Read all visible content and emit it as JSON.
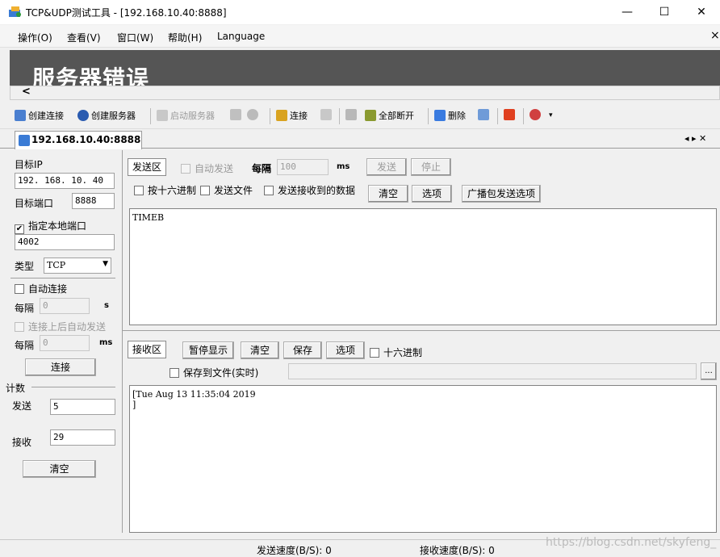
{
  "window": {
    "title": "TCP&UDP测试工具 - [192.168.10.40:8888]",
    "minimize": "—",
    "maximize": "☐",
    "close": "✕"
  },
  "menu": {
    "items": [
      "操作(O)",
      "查看(V)",
      "窗口(W)",
      "帮助(H)",
      "Language"
    ],
    "close": "×"
  },
  "banner": {
    "title": "服务器错误",
    "scroll_arrow": "<"
  },
  "toolbar": {
    "create_connection": "创建连接",
    "create_server": "创建服务器",
    "start_server": "启动服务器",
    "connect": "连接",
    "disconnect_all": "全部断开",
    "delete": "删除",
    "overflow": "▾"
  },
  "tabs": {
    "active": "192.168.10.40:8888",
    "nav": "◂ ▸ ✕"
  },
  "left": {
    "target_ip_label": "目标IP",
    "target_ip_value": "192. 168. 10. 40",
    "target_port_label": "目标端口",
    "target_port_value": "8888",
    "local_port_checkbox": "指定本地端口",
    "local_port_checked": "✔",
    "local_port_value": "4002",
    "type_label": "类型",
    "type_value": "TCP",
    "auto_connect": "自动连接",
    "interval_label": "每隔",
    "interval_value": "0",
    "interval_unit": "s",
    "auto_send_after": "连接上后自动发送",
    "interval2_label": "每隔",
    "interval2_value": "0",
    "interval2_unit": "ms",
    "connect_button": "连接",
    "count_label": "计数",
    "send_label": "发送",
    "send_value": "5",
    "recv_label": "接收",
    "recv_value": "29",
    "clear_button": "清空"
  },
  "send_area": {
    "title": "发送区",
    "auto_send": "自动发送",
    "interval_label": "每隔",
    "interval_value": "100",
    "interval_unit": "ms",
    "send_button": "发送",
    "stop_button": "停止",
    "hex_send": "按十六进制",
    "send_file": "发送文件",
    "send_received": "发送接收到的数据",
    "clear_button": "清空",
    "options_button": "选项",
    "broadcast_button": "广播包发送选项",
    "content": "TIMEB"
  },
  "recv_area": {
    "title": "接收区",
    "pause_button": "暂停显示",
    "clear_button": "清空",
    "save_button": "保存",
    "options_button": "选项",
    "hex": "十六进制",
    "save_to_file": "保存到文件(实时)",
    "browse_button": "...",
    "content": "[Tue Aug 13 11:35:04 2019\n]"
  },
  "status": {
    "send_speed": "发送速度(B/S): 0",
    "recv_speed": "接收速度(B/S): 0"
  },
  "watermark": "https://blog.csdn.net/skyfeng_",
  "colors": {
    "banner_bg": "#555555",
    "tab_bg": "#ffffff",
    "window_bg": "#f0f0f0"
  }
}
